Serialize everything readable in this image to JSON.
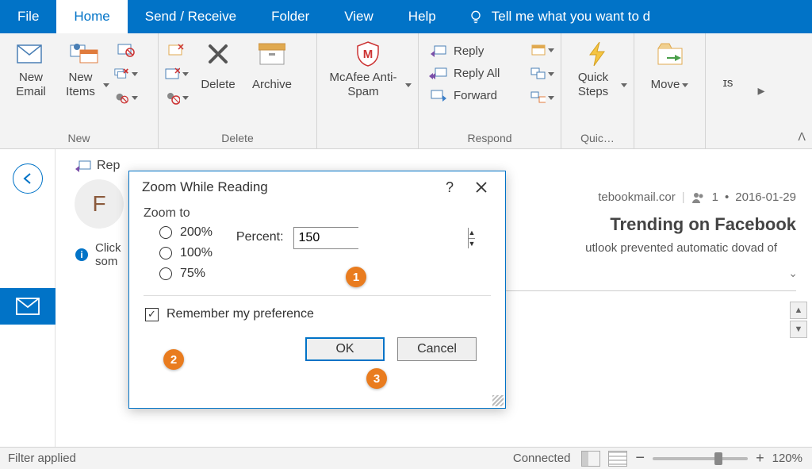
{
  "tabs": {
    "file": "File",
    "home": "Home",
    "sendreceive": "Send / Receive",
    "folder": "Folder",
    "view": "View",
    "help": "Help",
    "tellme": "Tell me what you want to d"
  },
  "ribbon": {
    "new_group": "New",
    "new_email": "New Email",
    "new_items": "New Items",
    "delete_group": "Delete",
    "delete": "Delete",
    "archive": "Archive",
    "mcafee": "McAfee Anti-Spam",
    "respond_group": "Respond",
    "reply": "Reply",
    "reply_all": "Reply All",
    "forward": "Forward",
    "quick_group": "Quic…",
    "quick_steps": "Quick Steps",
    "move": "Move",
    "js": "ɪs"
  },
  "message": {
    "reply_action": "Rep",
    "avatar_initial": "F",
    "info_click": "Click",
    "info_som": "som",
    "from_domain": "tebookmail.cor",
    "recip_count": "1",
    "date": "2016-01-29",
    "subject": "Trending on Facebook",
    "warning": "utlook prevented automatic dovad of"
  },
  "dialog": {
    "title": "Zoom While Reading",
    "zoom_to": "Zoom to",
    "opt200": "200%",
    "opt100": "100%",
    "opt75": "75%",
    "percent_label": "Percent:",
    "percent_value": "150",
    "remember": "Remember my preference",
    "ok": "OK",
    "cancel": "Cancel"
  },
  "callouts": {
    "c1": "1",
    "c2": "2",
    "c3": "3"
  },
  "status": {
    "filter": "Filter applied",
    "connected": "Connected",
    "zoom": "120%",
    "minus": "−",
    "plus": "+"
  }
}
